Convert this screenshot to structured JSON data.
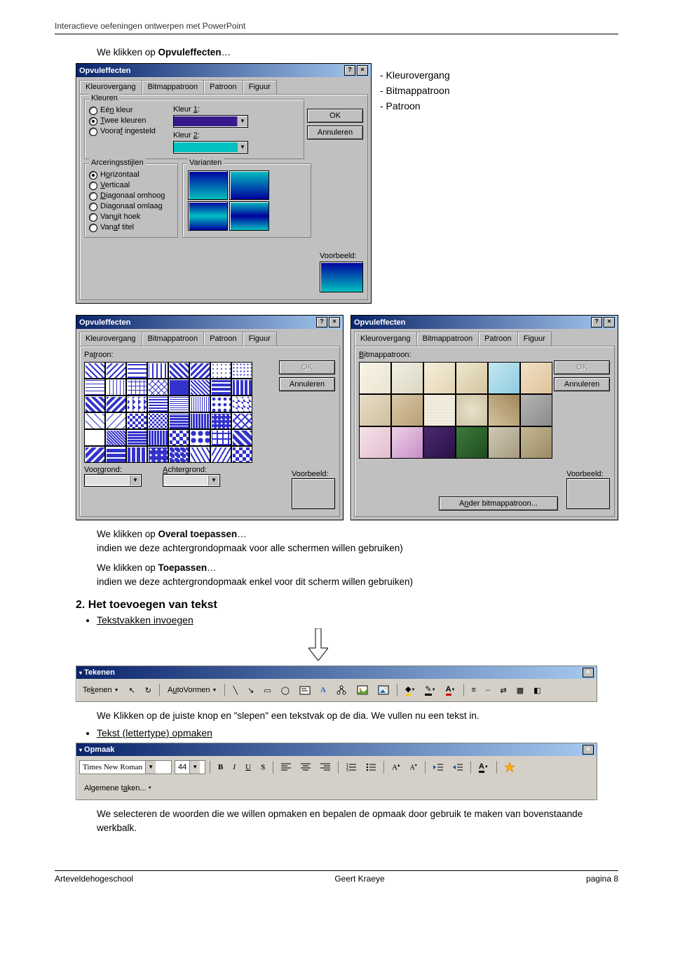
{
  "header": "Interactieve oefeningen ontwerpen met PowerPoint",
  "intro_prefix": "We klikken op ",
  "intro_bold": "Opvuleffecten",
  "intro_suffix": "…",
  "sidenotes": [
    "- Kleurovergang",
    "- Bitmappatroon",
    "- Patroon"
  ],
  "dialog1": {
    "title": "Opvuleffecten",
    "tabs": [
      "Kleurovergang",
      "Bitmappatroon",
      "Patroon",
      "Figuur"
    ],
    "active": 0,
    "ok": "OK",
    "cancel": "Annuleren",
    "group_colors": "Kleuren",
    "radios_colors": [
      "Eén kleur",
      "Twee kleuren",
      "Vooraf ingesteld"
    ],
    "kleur1": "Kleur 1:",
    "kleur2": "Kleur 2:",
    "group_styles": "Arceringsstijlen",
    "radios_styles": [
      "Horizontaal",
      "Verticaal",
      "Diagonaal omhoog",
      "Diagonaal omlaag",
      "Vanuit hoek",
      "Vanaf titel"
    ],
    "group_var": "Varianten",
    "voorbeeld": "Voorbeeld:"
  },
  "dialog2": {
    "title": "Opvuleffecten",
    "tabs": [
      "Kleurovergang",
      "Bitmappatroon",
      "Patroon",
      "Figuur"
    ],
    "active": 2,
    "ok": "OK",
    "cancel": "Annuleren",
    "label": "Patroon:",
    "voorgrond": "Voorgrond:",
    "achtergrond": "Achtergrond:",
    "voorbeeld": "Voorbeeld:"
  },
  "dialog3": {
    "title": "Opvuleffecten",
    "tabs": [
      "Kleurovergang",
      "Bitmappatroon",
      "Patroon",
      "Figuur"
    ],
    "active": 1,
    "ok": "OK",
    "cancel": "Annuleren",
    "label": "Bitmappatroon:",
    "other": "Ander bitmappatroon...",
    "voorbeeld": "Voorbeeld:"
  },
  "para1": {
    "line1_a": "We klikken op ",
    "line1_b": "Overal toepassen",
    "line1_c": "…",
    "line2": "indien we deze achtergrondopmaak voor alle schermen willen gebruiken)",
    "line3_a": "We klikken op ",
    "line3_b": "Toepassen",
    "line3_c": "…",
    "line4": "indien we deze achtergrondopmaak enkel voor dit scherm willen gebruiken)"
  },
  "section2": {
    "heading": "2. Het toevoegen van tekst",
    "bullet1": "Tekstvakken invoegen"
  },
  "toolbar_draw": {
    "title": "Tekenen",
    "draw_menu": "Tekenen",
    "autovormen": "AutoVormen"
  },
  "para2": "We Klikken op de juiste knop en \"slepen\" een tekstvak op de dia. We vullen nu een tekst in.",
  "bullet2": "Tekst (lettertype) opmaken",
  "toolbar_format": {
    "title": "Opmaak",
    "font": "Times New Roman",
    "size": "44",
    "B": "B",
    "I": "I",
    "U": "U",
    "S": "S",
    "algemeen": "Algemene taken..."
  },
  "para3": "We selecteren de woorden die we willen opmaken en bepalen de opmaak door gebruik te maken van bovenstaande werkbalk.",
  "footer": {
    "left": "Arteveldehogeschool",
    "center": "Geert Kraeye",
    "right": "pagina 8"
  }
}
